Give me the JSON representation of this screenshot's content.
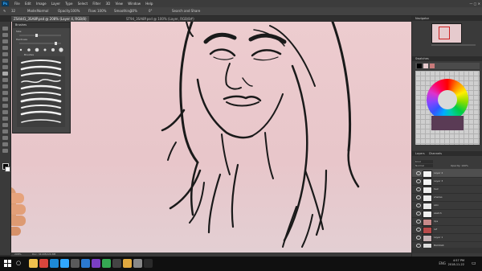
{
  "app": {
    "logo_text": "Ps",
    "menus": [
      "File",
      "Edit",
      "Image",
      "Layer",
      "Type",
      "Select",
      "Filter",
      "3D",
      "View",
      "Window",
      "Help"
    ],
    "window_controls": "—  ▢  ✕",
    "colors": {
      "accent": "#31a8ff",
      "canvas_bg": "#edcccf",
      "chrome": "#3c3c3c",
      "panel": "#3a3a3a",
      "taskbar": "#101010"
    }
  },
  "options_bar": {
    "size_value": "32",
    "mode_label": "Mode:",
    "mode_value": "Normal",
    "opacity_label": "Opacity:",
    "opacity_value": "100%",
    "flow_label": "Flow:",
    "flow_value": "100%",
    "smoothing_label": "Smoothing:",
    "smoothing_value": "10%",
    "angle_value": "0°",
    "search_label": "Search and Share"
  },
  "document": {
    "active_tab": "ZS4dd1_3SA8P.psd @ 208% (Layer 4, RGB/8)",
    "second_tab": "ST94_3SA8P.psd @ 100% (Layer, RGB/8#)",
    "status_zoom": "208%",
    "status_doc": "Doc: 34.0M/220.8M"
  },
  "brushes_panel": {
    "title": "Brushes",
    "size_label": "Size:",
    "preset_label": "Brushes",
    "hardness_label": "Hardness"
  },
  "navigator": {
    "title": "Navigator"
  },
  "swatches": {
    "title": "Swatches"
  },
  "layers_panel": {
    "tabs": [
      "Layers",
      "Channels"
    ],
    "kind_label": "Kind",
    "blend_mode": "Normal",
    "opacity_label": "Opacity: 100%",
    "fill_label": "Fill: 100%",
    "layers": [
      {
        "name": "Layer 4",
        "selected": true,
        "thumb": "#f3f3f3"
      },
      {
        "name": "Layer 3",
        "selected": false,
        "thumb": "#f3f3f3"
      },
      {
        "name": "hair",
        "selected": false,
        "thumb": "#ededed"
      },
      {
        "name": "shades",
        "selected": false,
        "thumb": "#ededed"
      },
      {
        "name": "skin",
        "selected": false,
        "thumb": "#e9e9e9"
      },
      {
        "name": "sketch",
        "selected": false,
        "thumb": "#f0f0f0"
      },
      {
        "name": "lips",
        "selected": false,
        "thumb": "#c98a8a"
      },
      {
        "name": "ref",
        "selected": false,
        "thumb": "#b94a4a"
      },
      {
        "name": "Layer 1",
        "selected": false,
        "thumb": "#c7b2b5"
      },
      {
        "name": "BACKGR",
        "selected": false,
        "thumb": "#dcdcdc"
      }
    ]
  },
  "taskbar": {
    "apps": [
      {
        "name": "file-explorer-icon",
        "color": "#f2c14e"
      },
      {
        "name": "chrome-icon",
        "color": "#d9463c"
      },
      {
        "name": "edge-icon",
        "color": "#1e8ad6"
      },
      {
        "name": "photoshop-icon",
        "color": "#31a8ff"
      },
      {
        "name": "store-icon",
        "color": "#5a5a5a"
      },
      {
        "name": "mail-icon",
        "color": "#2b79d0"
      },
      {
        "name": "media-icon",
        "color": "#7b3fc3"
      },
      {
        "name": "app-icon",
        "color": "#35a853"
      },
      {
        "name": "terminal-icon",
        "color": "#444"
      },
      {
        "name": "folder-icon",
        "color": "#e1a93f"
      },
      {
        "name": "settings-icon",
        "color": "#888"
      },
      {
        "name": "obs-icon",
        "color": "#2a2a2a"
      }
    ],
    "time": "4:57 PM",
    "date": "2018-11-22",
    "lang": "ENG"
  }
}
